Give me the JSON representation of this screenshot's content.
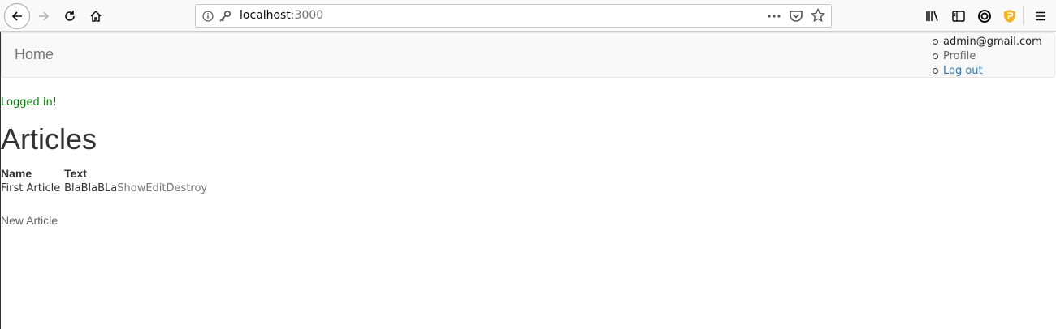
{
  "browser": {
    "url_host": "localhost",
    "url_port": ":3000",
    "icons": {
      "back": "back-arrow-icon",
      "forward": "forward-arrow-icon",
      "reload": "reload-icon",
      "home": "home-icon",
      "info": "info-icon",
      "key": "key-icon",
      "more": "more-dots-icon",
      "pocket": "pocket-icon",
      "bookmark": "star-icon",
      "library": "library-icon",
      "sidebar": "sidebar-icon",
      "menu": "hamburger-menu-icon"
    }
  },
  "navbar": {
    "brand": "Home",
    "user_menu": {
      "email": "admin@gmail.com",
      "profile": "Profile",
      "logout": "Log out"
    }
  },
  "notice": "Logged in!",
  "page_title": "Articles",
  "table": {
    "headers": [
      "Name",
      "Text"
    ],
    "rows": [
      {
        "name": "First Article",
        "text": "BlaBlaBLa",
        "actions": [
          "Show",
          "Edit",
          "Destroy"
        ]
      }
    ]
  },
  "new_article_link": "New Article",
  "colors": {
    "notice": "#008000",
    "link_blue": "#337ab7",
    "navbar_bg": "#f8f8f8"
  }
}
